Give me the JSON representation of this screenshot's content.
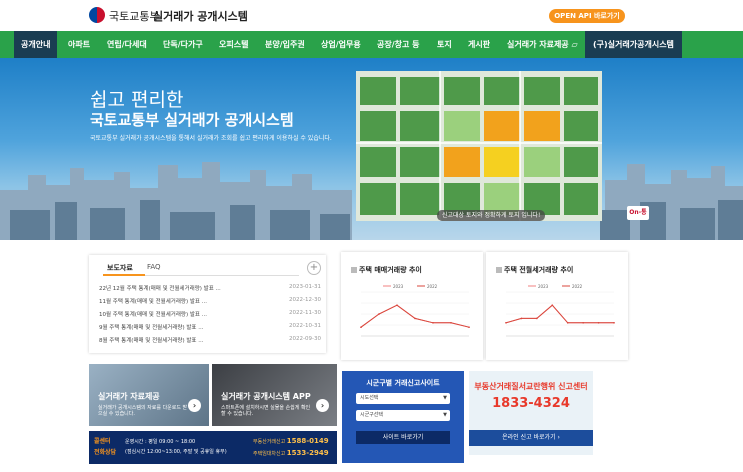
{
  "header": {
    "org_name": "국토교통부",
    "site_name": "실거래가 공개시스템",
    "open_api_label": "OPEN API 바로가기"
  },
  "nav": {
    "items": [
      {
        "label": "공개안내"
      },
      {
        "label": "아파트"
      },
      {
        "label": "연립/다세대"
      },
      {
        "label": "단독/다가구"
      },
      {
        "label": "오피스텔"
      },
      {
        "label": "분양/입주권"
      },
      {
        "label": "상업/업무용"
      },
      {
        "label": "공장/창고 등"
      },
      {
        "label": "토지"
      },
      {
        "label": "게시판"
      },
      {
        "label": "실거래가 자료제공 ▱"
      },
      {
        "label": "(구)실거래가공개시스템"
      }
    ]
  },
  "hero": {
    "subtitle": "쉽고 편리한",
    "title": "국토교통부 실거래가 공개시스템",
    "description": "국토교통부 실거래가 공개시스템을 통해서 실거래가 조회를 쉽고 편리하게 이용하실 수 있습니다.",
    "map_caption": "신고대상 토지와 정확하게 토지 입니다!",
    "map_logo": "On-통"
  },
  "board": {
    "tab_news": "보도자료",
    "tab_faq": "FAQ",
    "plus": "+",
    "items": [
      {
        "title": "22년 12월 주택 통계(매매 및 전월세거래량) 발표 ...",
        "date": "2023-01-31"
      },
      {
        "title": "11월 주택 통계(매매 및 전월세거래량) 발표 ...",
        "date": "2022-12-30"
      },
      {
        "title": "10월 주택 통계(매매 및 전월세거래량) 발표 ...",
        "date": "2022-11-30"
      },
      {
        "title": "9월 주택 통계(매매 및 전월세거래량) 발표 ...",
        "date": "2022-10-31"
      },
      {
        "title": "8월 주택 통계(매매 및 전월세거래량) 발표 ...",
        "date": "2022-09-30"
      }
    ]
  },
  "charts": {
    "sale_title": "주택 매매거래량 추이",
    "rent_title": "주택 전월세거래량 추이"
  },
  "chart_data": [
    {
      "type": "line",
      "title": "주택 매매거래량 추이",
      "series": [
        {
          "name": "2023",
          "values": [
            2,
            5,
            7,
            4,
            3,
            3,
            2
          ]
        },
        {
          "name": "2022",
          "values": [
            2,
            5,
            7,
            4,
            3,
            3,
            2
          ]
        }
      ],
      "ylim": [
        0,
        10
      ]
    },
    {
      "type": "line",
      "title": "주택 전월세거래량 추이",
      "series": [
        {
          "name": "2023",
          "values": [
            3,
            4,
            4,
            7,
            3,
            3,
            3,
            3
          ]
        },
        {
          "name": "2022",
          "values": [
            3,
            4,
            4,
            7,
            3,
            3,
            3,
            3
          ]
        }
      ],
      "ylim": [
        0,
        10
      ]
    }
  ],
  "banners": {
    "data_title": "실거래가 자료제공",
    "data_desc": "실거래가 공개시스템의 자료를 다운로드 받으실 수 있습니다.",
    "app_title": "실거래가 공개시스템 APP",
    "app_desc": "스마트폰에 설치하시면 실물을 손쉽게 확인 할 수 있습니다.",
    "arrow": "›"
  },
  "call": {
    "label1": "콜센터",
    "label2": "전화상담",
    "hours1": "운영시간 : 평일 09:00 ~ 18:00",
    "hours2": "(점심시간 12:00~13:00, 주말 및 공휴일 휴무)",
    "num1_label": "부동산거래신고",
    "num1": "1588-0149",
    "num2_label": "주택임대차신고",
    "num2": "1533-2949"
  },
  "site_report": {
    "title": "시군구별 거래신고사이트",
    "select1": "시도선택",
    "select2": "시군구선택",
    "button": "사이트 바로가기"
  },
  "report_center": {
    "title": "부동산거래질서교란행위 신고센터",
    "phone": "1833-4324",
    "button": "온라인 신고 바로가기 ›"
  }
}
